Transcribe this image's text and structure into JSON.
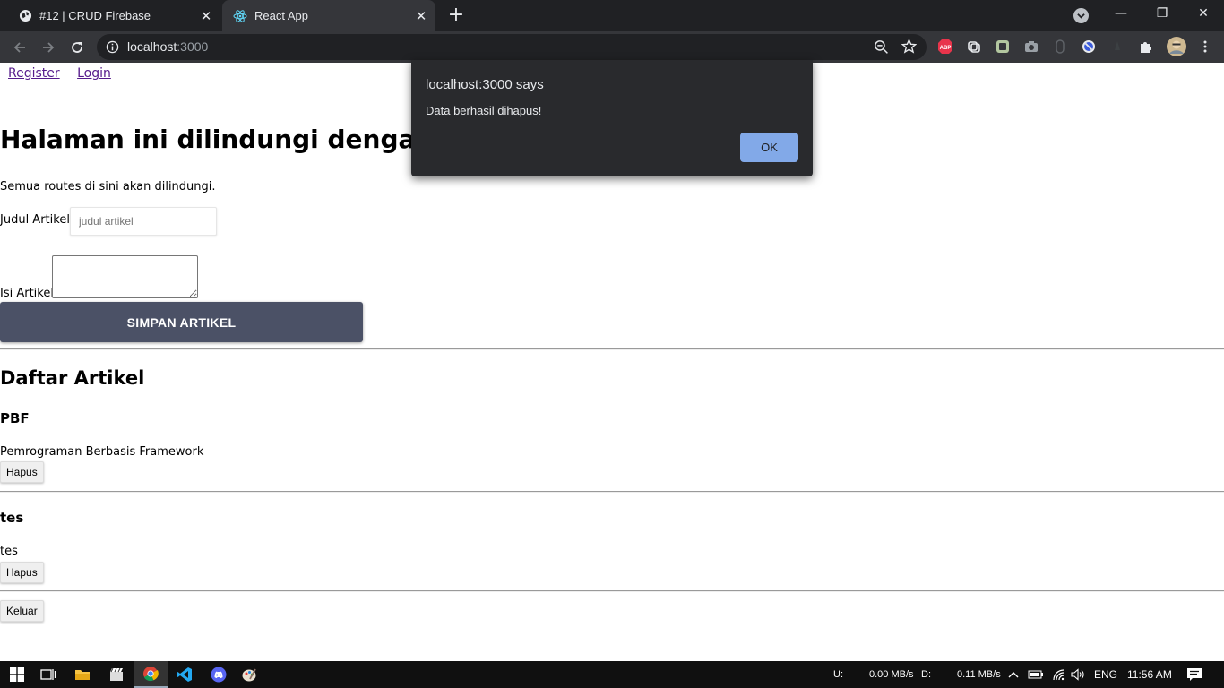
{
  "browser": {
    "tabs": [
      {
        "title": "#12 | CRUD Firebase",
        "active": false
      },
      {
        "title": "React App",
        "active": true
      }
    ],
    "address": {
      "host": "localhost",
      "port": ":3000"
    }
  },
  "page": {
    "nav": {
      "register": "Register",
      "login": "Login"
    },
    "heading": "Halaman ini dilindungi dengan pa",
    "description": "Semua routes di sini akan dilindungi.",
    "form": {
      "title_label": "Judul Artikel",
      "title_placeholder": "judul artikel",
      "body_label": "Isi Artikel",
      "save_button": "SIMPAN ARTIKEL"
    },
    "list_heading": "Daftar Artikel",
    "articles": [
      {
        "title": "PBF",
        "body": "Pemrograman Berbasis Framework",
        "delete": "Hapus"
      },
      {
        "title": "tes",
        "body": "tes",
        "delete": "Hapus"
      }
    ],
    "logout_button": "Keluar"
  },
  "dialog": {
    "title": "localhost:3000 says",
    "message": "Data berhasil dihapus!",
    "ok": "OK"
  },
  "taskbar": {
    "net_up_label": "U:",
    "net_up": "0.00 MB/s",
    "net_down_label": "D:",
    "net_down": "0.11 MB/s",
    "lang": "ENG",
    "time": "11:56 AM"
  }
}
